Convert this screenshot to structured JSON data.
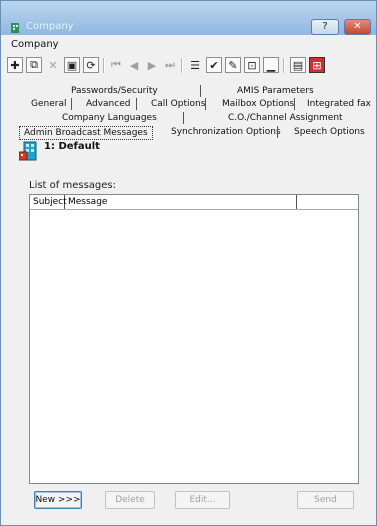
{
  "window": {
    "title": "Company",
    "help_label": "?",
    "close_label": "✕"
  },
  "menu": {
    "company": "Company"
  },
  "toolbar": {
    "icons": [
      "add-icon",
      "copy-icon",
      "delete-icon",
      "save-icon",
      "refresh-icon",
      "first-record-icon",
      "prev-record-icon",
      "next-record-icon",
      "last-record-icon",
      "list-icon",
      "check-icon",
      "edit-icon",
      "view-icon",
      "chart-icon",
      "report-icon",
      "grid-icon"
    ]
  },
  "tabs": {
    "row1": [
      "Passwords/Security",
      "AMIS Parameters"
    ],
    "row2": [
      "General",
      "Advanced",
      "Call Options",
      "Mailbox Options",
      "Integrated fax"
    ],
    "row3": [
      "Company Languages",
      "C.O./Channel Assignment"
    ],
    "row4": [
      "Admin Broadcast Messages",
      "Synchronization Options",
      "Speech Options"
    ]
  },
  "entity": {
    "label": "1: Default"
  },
  "list": {
    "label": "List of messages:",
    "columns": [
      "Subject",
      "Message",
      ""
    ]
  },
  "buttons": {
    "new": "New >>>",
    "delete": "Delete",
    "edit": "Edit...",
    "send": "Send"
  }
}
